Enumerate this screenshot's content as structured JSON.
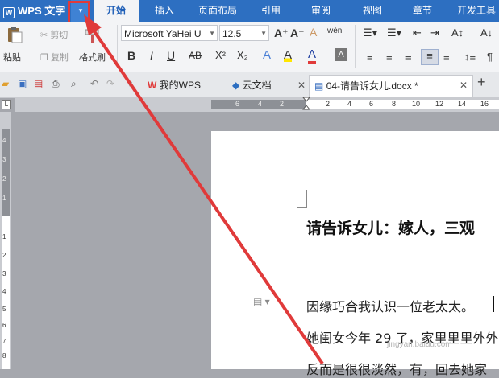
{
  "menubar": {
    "app_title": "WPS 文字",
    "dropdown_glyph": "▾",
    "tabs": [
      "开始",
      "插入",
      "页面布局",
      "引用",
      "审阅",
      "视图",
      "章节",
      "开发工具"
    ]
  },
  "ribbon": {
    "paste": "粘贴",
    "cut": "剪切",
    "copy": "复制",
    "format_painter": "格式刷",
    "font_name": "Microsoft YaHei U",
    "font_size": "12.5",
    "bold": "B",
    "italic": "I",
    "underline": "U",
    "strikethrough": "AB",
    "superscript": "X²",
    "subscript": "X₂",
    "grow_font": "A⁺",
    "shrink_font": "A⁻",
    "clear_format": "A",
    "phonetic": "wén",
    "font_color": "A",
    "highlight": "A"
  },
  "tabstrip": {
    "my_wps": "我的WPS",
    "cloud_docs": "云文档",
    "doc_tab": "04-请告诉女儿.docx *",
    "new_tab": "+"
  },
  "ruler": {
    "h_ticks": [
      "6",
      "4",
      "2",
      "2",
      "4",
      "6",
      "8",
      "10",
      "12",
      "14",
      "16"
    ],
    "v_ticks": [
      "4",
      "3",
      "2",
      "1",
      "1",
      "2",
      "3",
      "4",
      "5",
      "6",
      "7",
      "8",
      "9"
    ]
  },
  "document": {
    "heading": "请告诉女儿：嫁人，三观",
    "para1": "因缘巧合我认识一位老太太。",
    "para2": "她闺女今年 29 了，家里里里外外",
    "para3": "反而是很很淡然，有，回去她家"
  },
  "watermark": "jingyan.baidu.com",
  "colors": {
    "menubar": "#2d6fc1",
    "accent_red": "#e03a3a",
    "active_tab_text": "#1f5fb7"
  }
}
